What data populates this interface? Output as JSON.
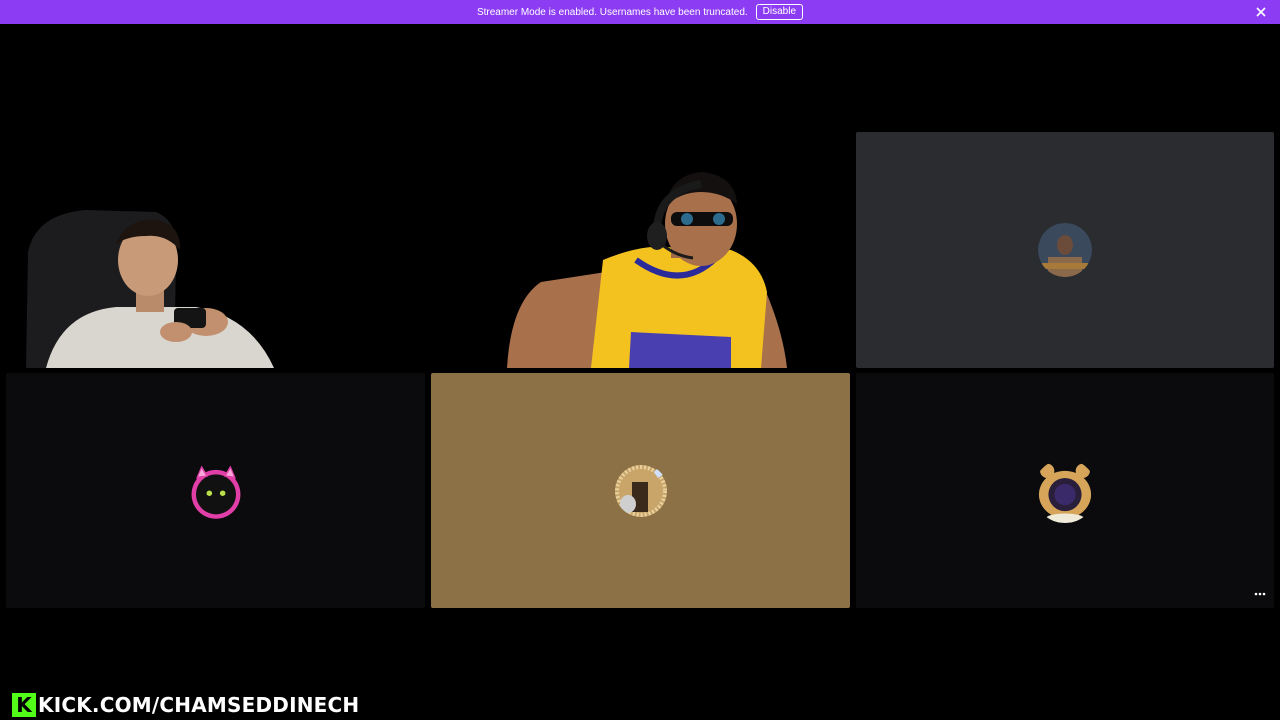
{
  "banner": {
    "message": "Streamer Mode is enabled. Usernames have been truncated.",
    "disable_label": "Disable",
    "close_icon": "close-icon",
    "background": "#8c3df4"
  },
  "tiles": [
    {
      "kind": "camera",
      "description_icon": "video-feed"
    },
    {
      "kind": "camera",
      "description_icon": "video-feed"
    },
    {
      "kind": "avatar",
      "background": "#2b2c30"
    },
    {
      "kind": "avatar",
      "background": "#0b0b0d"
    },
    {
      "kind": "avatar",
      "background": "#8c7146"
    },
    {
      "kind": "avatar",
      "background": "#0b0b0e"
    }
  ],
  "more_options_icon": "more-horizontal-icon",
  "brand": {
    "logo_letter": "K",
    "text": "KICK.COM/CHAMSEDDINECH",
    "logo_color": "#53fc18"
  }
}
